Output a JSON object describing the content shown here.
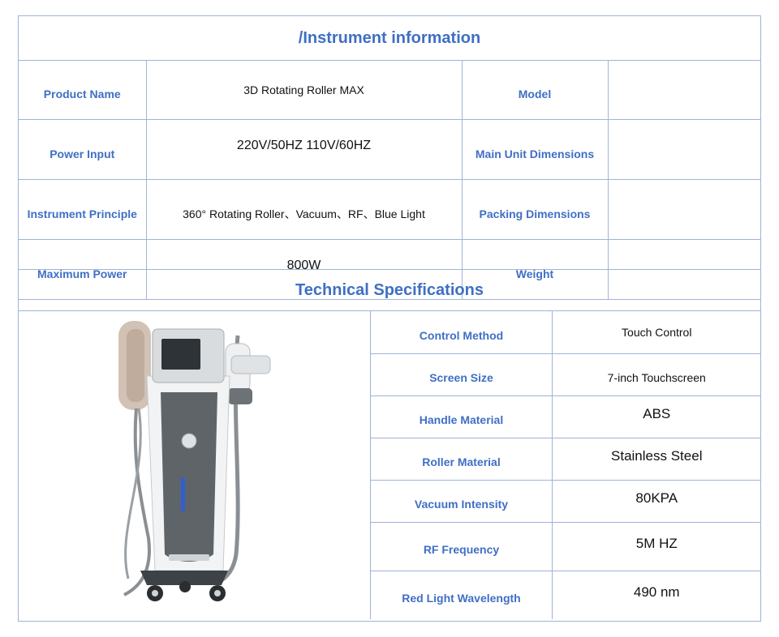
{
  "header": {
    "title": "/Instrument information"
  },
  "info_rows": [
    {
      "label1": "Product Name",
      "value1": "3D Rotating Roller MAX",
      "label2": "Model",
      "value2": ""
    },
    {
      "label1": "Power Input",
      "value1": "220V/50HZ  110V/60HZ",
      "label2": "Main Unit Dimensions",
      "value2": ""
    },
    {
      "label1": "Instrument Principle",
      "value1": "360° Rotating Roller、Vacuum、RF、Blue Light",
      "label2": "Packing Dimensions",
      "value2": ""
    },
    {
      "label1": "Maximum Power",
      "value1": "800W",
      "label2": "Weight",
      "value2": ""
    }
  ],
  "specs": {
    "title": "Technical Specifications",
    "rows": [
      {
        "label": "Control Method",
        "value": "Touch Control"
      },
      {
        "label": "Screen Size",
        "value": "7-inch Touchscreen"
      },
      {
        "label": "Handle Material",
        "value": "ABS"
      },
      {
        "label": "Roller Material",
        "value": "Stainless Steel"
      },
      {
        "label": "Vacuum Intensity",
        "value": "80KPA"
      },
      {
        "label": "RF Frequency",
        "value": "5M HZ"
      },
      {
        "label": "Red Light Wavelength",
        "value": "490 nm"
      }
    ]
  },
  "colors": {
    "accent": "#3f6fc4",
    "border": "#9fb3d9",
    "device_body": "#5f6468",
    "device_shell": "#f2f3f4",
    "screen": "#2e3338",
    "indicator": "#2f5fd0"
  },
  "image": {
    "icon": "beauty-device-machine-icon"
  }
}
